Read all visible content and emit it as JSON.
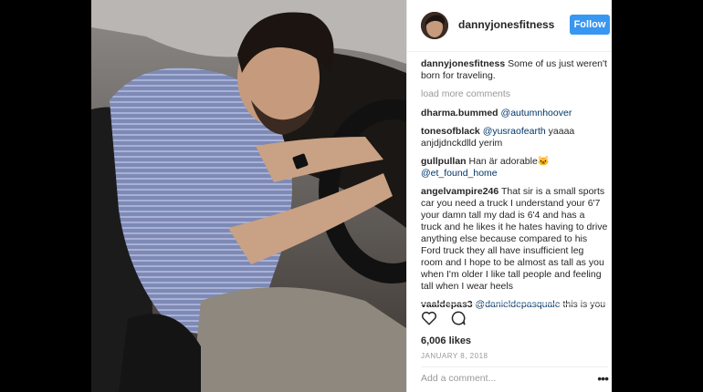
{
  "post": {
    "username": "dannyjonesfitness",
    "follow_label": "Follow",
    "caption_user": "dannyjonesfitness",
    "caption_text": "Some of us just weren't born for traveling.",
    "load_more": "load more comments",
    "comments": [
      {
        "user": "dharma.bummed",
        "mention": "@autumnhoover",
        "text": ""
      },
      {
        "user": "tonesofblack",
        "mention": "@yusraofearth",
        "text": "yaaaa anjdjdnckdlld yerim"
      },
      {
        "user": "gullpullan",
        "mention": "",
        "text": "Han är adorable🐱",
        "mention2": "@et_found_home"
      },
      {
        "user": "angelvampire246",
        "mention": "",
        "text": "That sir is a small sports car you need a truck I understand your 6'7 your damn tall my dad is 6'4 and has a truck and he likes it he hates having to drive anything else because compared to his Ford truck they all have insufficient leg room and I hope to be almost as tall as you when I'm older I like tall people and feeling tall when I wear heels"
      },
      {
        "user": "vaaldepas3",
        "mention": "@danieldepasquale",
        "text": "this is you"
      }
    ],
    "likes": "6,006 likes",
    "date": "JANUARY 8, 2018",
    "add_comment_placeholder": "Add a comment...",
    "more_label": "•••"
  }
}
